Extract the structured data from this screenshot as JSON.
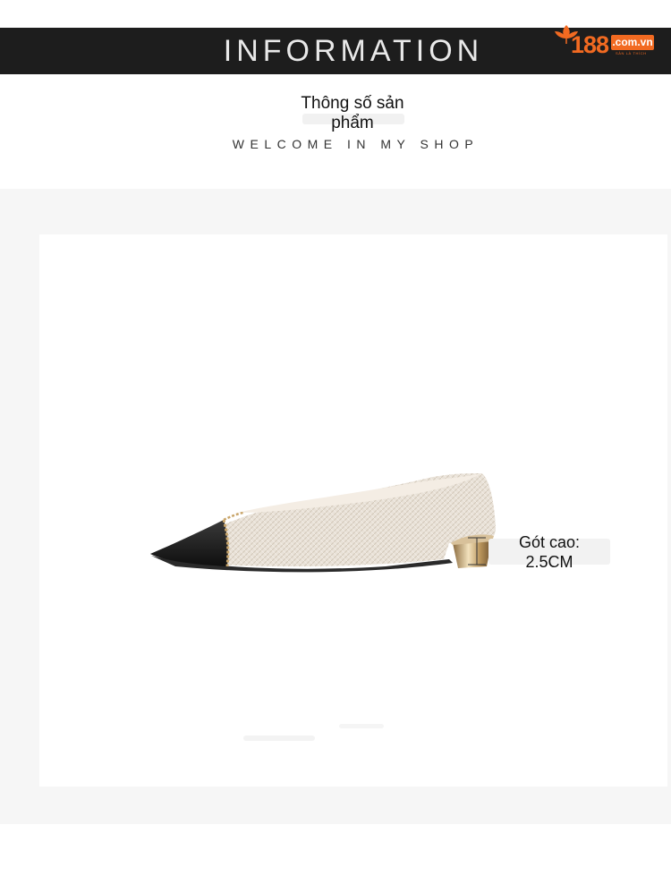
{
  "banner": {
    "title": "INFORMATION",
    "logo": {
      "number": "188",
      "domain": ".com.vn",
      "tagline": "SẢN LÀ THÍCH",
      "icon": "leaf-icon",
      "brand_color": "#f26a21"
    }
  },
  "heading": {
    "title": "Thông số sản phẩm",
    "subtitle": "WELCOME IN MY SHOP"
  },
  "product": {
    "image": "shoe-image",
    "heel_label": "Gót cao: 2.5CM"
  },
  "colors": {
    "banner_bg": "#1d1d1d",
    "section_bg": "#f6f6f6",
    "card_bg": "#ffffff"
  }
}
